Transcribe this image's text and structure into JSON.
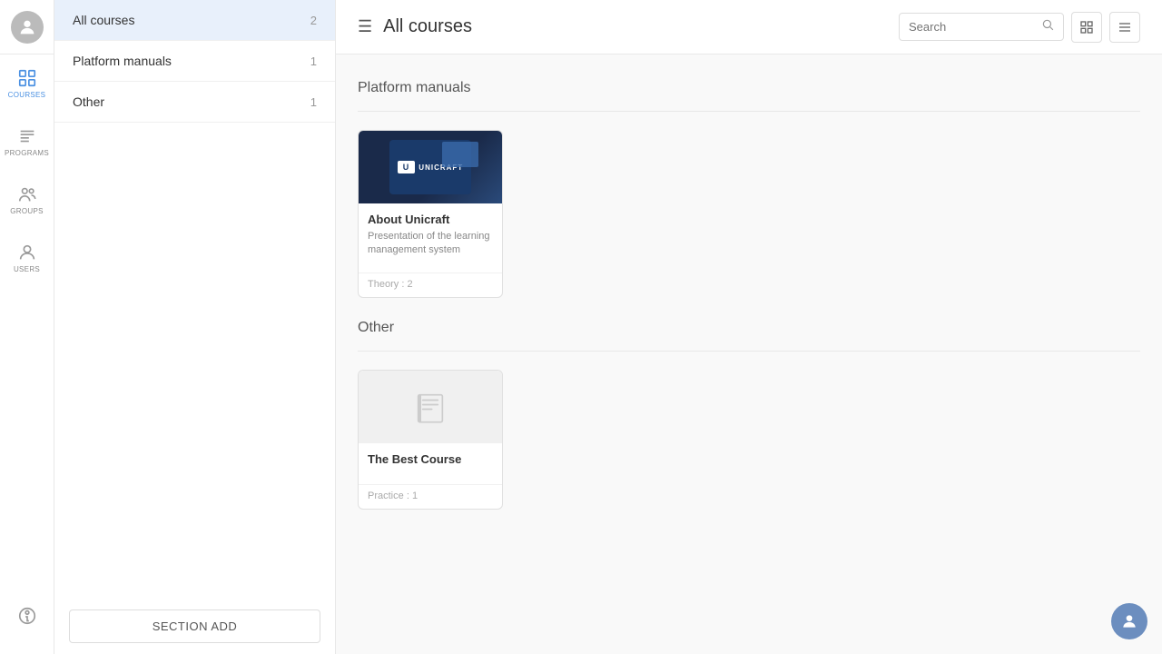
{
  "nav": {
    "items": [
      {
        "id": "courses",
        "label": "COURSES",
        "active": true
      },
      {
        "id": "programs",
        "label": "PROGRAMS",
        "active": false
      },
      {
        "id": "groups",
        "label": "GROUPS",
        "active": false
      },
      {
        "id": "users",
        "label": "USERS",
        "active": false
      }
    ],
    "bottom_icon": "help-icon"
  },
  "sidebar": {
    "all_courses_label": "All courses",
    "all_courses_count": "2",
    "sections": [
      {
        "id": "platform-manuals",
        "label": "Platform manuals",
        "count": "1"
      },
      {
        "id": "other",
        "label": "Other",
        "count": "1"
      }
    ],
    "add_button_label": "SECTION ADD"
  },
  "main": {
    "title": "All courses",
    "search_placeholder": "Search",
    "sections": [
      {
        "id": "platform-manuals",
        "title": "Platform manuals",
        "courses": [
          {
            "id": "about-unicraft",
            "title": "About Unicraft",
            "description": "Presentation of the learning management system",
            "footer_label": "Theory",
            "footer_count": "2",
            "has_image": true
          }
        ]
      },
      {
        "id": "other",
        "title": "Other",
        "courses": [
          {
            "id": "best-course",
            "title": "The Best Course",
            "description": "",
            "footer_label": "Practice",
            "footer_count": "1",
            "has_image": false
          }
        ]
      }
    ]
  },
  "icons": {
    "hamburger": "☰",
    "search": "🔍",
    "grid_view": "⊞",
    "list_view": "≡",
    "book": "📖",
    "support": "👤"
  }
}
